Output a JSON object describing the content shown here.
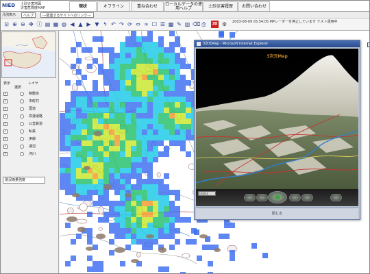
{
  "header": {
    "logo_mark": "NIED",
    "logo_line1": "土砂災害地図",
    "logo_line2": "災害危険度MAP",
    "tabs": [
      {
        "label": "現状"
      },
      {
        "label": "オフライン"
      },
      {
        "label": "重ね合わせ"
      },
      {
        "label": "ローカルデータの使用ヘルプ"
      },
      {
        "label": "土砂災害履歴"
      },
      {
        "label": "お問い合わせ"
      }
    ]
  },
  "subbar": {
    "legend_label": "凡例表示",
    "help_label": "ヘルプ",
    "link_select": "---関連するサイトへのリンク---"
  },
  "toolbar": {
    "tool_3d_label": "3D",
    "notice": "2003-08-09 05:54:05 MPレーダーを停止しています テスト運用中"
  },
  "layers": {
    "col_show": "表示",
    "col_select": "選択",
    "col_layer": "レイヤ",
    "items": [
      {
        "label": "移動体",
        "checked": true
      },
      {
        "label": "市町村",
        "checked": true
      },
      {
        "label": "国道",
        "checked": true
      },
      {
        "label": "高速道路",
        "checked": true
      },
      {
        "label": "公営鉄道",
        "checked": true
      },
      {
        "label": "私鉄",
        "checked": true
      },
      {
        "label": "JR線",
        "checked": true
      },
      {
        "label": "湖沼",
        "checked": true
      },
      {
        "label": "河川",
        "checked": true
      }
    ]
  },
  "layer_select": "現況雨量強度",
  "popup": {
    "title": "3次元Map - Microsoft Internet Explorer",
    "stage_title": "3次元Map",
    "field_value": "[data]",
    "status": "閉じる"
  },
  "colors": {
    "rain_low": "#3a6cf0",
    "rain_mid": "#18c8e8",
    "rain_high": "#22c06a",
    "rain_very_high": "#c8e62a",
    "rain_max": "#f39a2a",
    "terrain": "#8a7d6e",
    "prefecture": "#a27f74"
  }
}
